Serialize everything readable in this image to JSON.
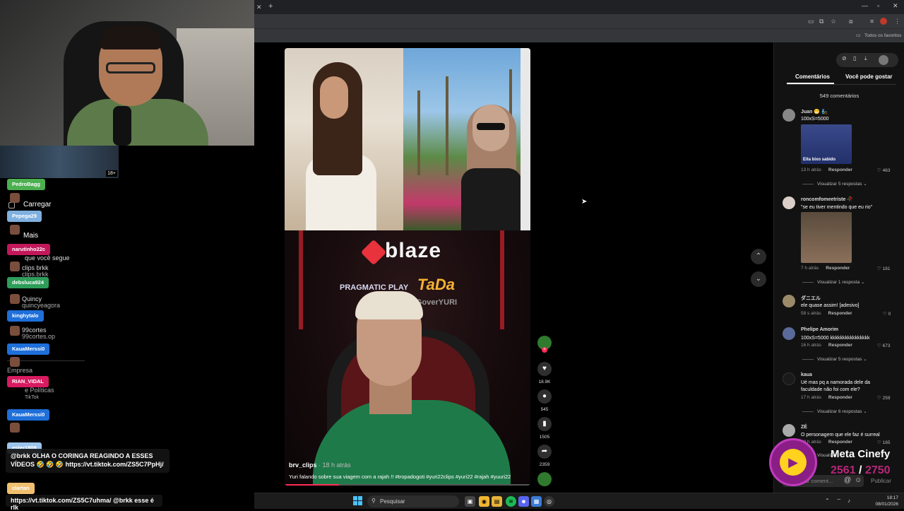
{
  "overlay": {
    "mini_badge": "18+",
    "sidebar": {
      "carregar": "Carregar",
      "mais": "Mais",
      "segue_label": "que você segue",
      "accounts": [
        {
          "name": "clips brkk",
          "handle": "clips.brkk"
        },
        {
          "name": "Quincy",
          "handle": "quincyeagora"
        },
        {
          "name": "99cortes",
          "handle": "99cortes.op"
        }
      ],
      "empresa": "Empresa",
      "politicas": "e Políticas",
      "tiktok": "TikTok"
    },
    "chat_names": [
      {
        "name": "PedroBagg",
        "color": "#4caf50"
      },
      {
        "name": "Pepega29",
        "color": "#7fb0e0"
      },
      {
        "name": "narutinho22c",
        "color": "#c2185b"
      },
      {
        "name": "debsluca924",
        "color": "#2e9d5a"
      },
      {
        "name": "kinghytalo",
        "color": "#1e6fd9"
      },
      {
        "name": "KauaMerssi0",
        "color": "#1e6fd9"
      },
      {
        "name": "RIAN_VIDAL",
        "color": "#d81b60"
      },
      {
        "name": "KauaMerssi0",
        "color": "#1e6fd9"
      },
      {
        "name": "ester1809",
        "color": "#9cc4ec"
      },
      {
        "name": "clartan",
        "color": "#f0c070"
      }
    ],
    "chat_message_1": "@brkk OLHA O CORINGA REAGINDO A ESSES VÍDEOS 🤣 🤣 🤣 https://vt.tiktok.com/ZS5C7PpHj/",
    "chat_message_2": "https://vt.tiktok.com/ZS5C7uhma/ @brkk esse é rlk"
  },
  "browser": {
    "bookmarks_label": "Todos os favoritos"
  },
  "video": {
    "brand": "blaze",
    "sponsor_1": "PRAGMATIC PLAY",
    "sponsor_2": "TaDa",
    "sign": "GoverYURI",
    "author": "brv_clips",
    "time": "· 18 h atrás",
    "description": "Yuri falando sobre sua viagem com a rajah !! #tropadogoti #yuri22clips #yuri22 #rajah #yuuri22",
    "progress": 0.22
  },
  "actions": {
    "likes": "18.9K",
    "comments": "545",
    "saves": "1505",
    "shares": "2359"
  },
  "comments_panel": {
    "tab_comments": "Comentários",
    "tab_like": "Você pode gostar",
    "count": "549 comentários",
    "items": [
      {
        "user": "Juan 😁 🧞",
        "text": "100xS=5000",
        "img_caption": "Eita bixo sabido",
        "time": "13 h atrás",
        "reply": "Responder",
        "likes": "463",
        "replies": "Visualizar 5 respostas ⌄"
      },
      {
        "user": "roncomfomeetriste 🥀",
        "text": "\"se eu tiver mentindo que eu rio\"",
        "time": "7 h atrás",
        "reply": "Responder",
        "likes": "181",
        "replies": "Visualizar 1 resposta ⌄"
      },
      {
        "user": "ダニエル",
        "text": "ele quase assim! [adesivo]",
        "time": "58 s atrás",
        "reply": "Responder",
        "likes": "0"
      },
      {
        "user": "Phelipe Amorim",
        "text": "100xS=5000 kkkkkkkkkkkkkkkk",
        "time": "16 h atrás",
        "reply": "Responder",
        "likes": "673",
        "replies": "Visualizar 5 respostas ⌄"
      },
      {
        "user": "kaua",
        "text": "Ué mas pq a namorada dele da faculdade não foi com ele?",
        "time": "17 h atrás",
        "reply": "Responder",
        "likes": "259",
        "replies": "Visualizar 6 respostas ⌄"
      },
      {
        "user": "ZÉ",
        "text": "O personagem que ele faz é surreal",
        "time": "20 h atrás",
        "reply": "Responder",
        "likes": "165",
        "replies": "Visualizar"
      }
    ],
    "input_placeholder": "Adicionar coment...",
    "publish": "Publicar"
  },
  "cinefy": {
    "title": "Meta Cinefy",
    "current": "2561",
    "separator": "/",
    "goal": "2750"
  },
  "taskbar": {
    "search": "Pesquisar",
    "time": "18:17",
    "date": "08/01/2026"
  }
}
